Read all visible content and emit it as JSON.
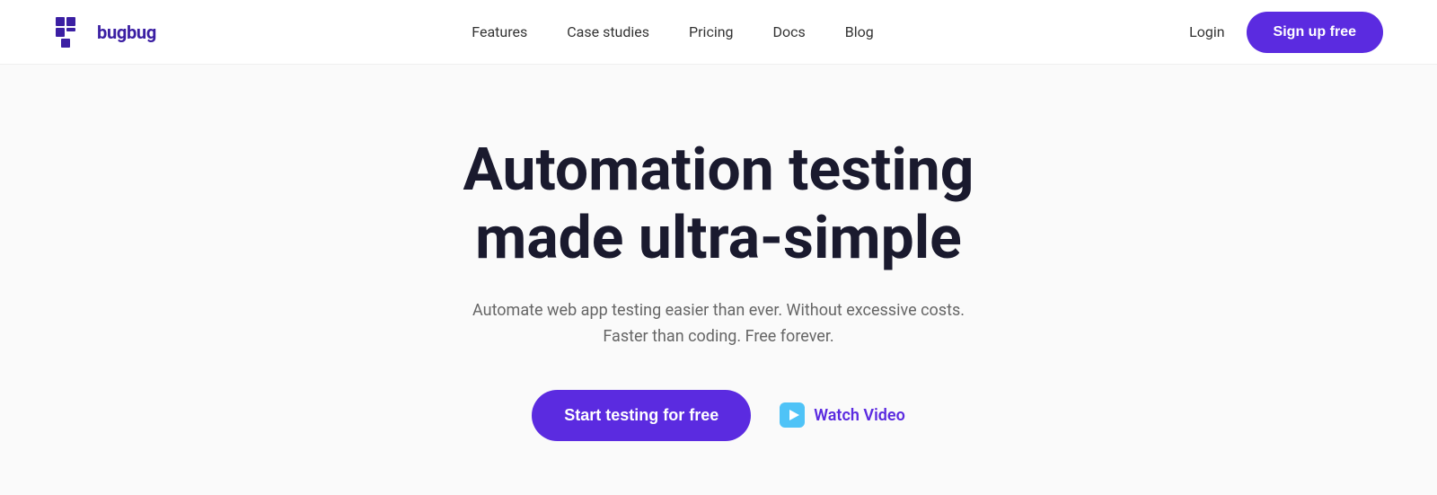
{
  "nav": {
    "logo_text": "bugbug",
    "links": [
      {
        "label": "Features",
        "id": "features"
      },
      {
        "label": "Case studies",
        "id": "case-studies"
      },
      {
        "label": "Pricing",
        "id": "pricing"
      },
      {
        "label": "Docs",
        "id": "docs"
      },
      {
        "label": "Blog",
        "id": "blog"
      }
    ],
    "login_label": "Login",
    "signup_label": "Sign up free"
  },
  "hero": {
    "title_line1": "Automation testing",
    "title_line2": "made ultra-simple",
    "subtitle_line1": "Automate web app testing easier than ever. Without excessive costs.",
    "subtitle_line2": "Faster than coding. Free forever.",
    "cta_primary": "Start testing for free",
    "cta_secondary": "Watch Video"
  },
  "colors": {
    "brand_purple": "#5b2be0",
    "logo_purple": "#3b1fa3"
  }
}
